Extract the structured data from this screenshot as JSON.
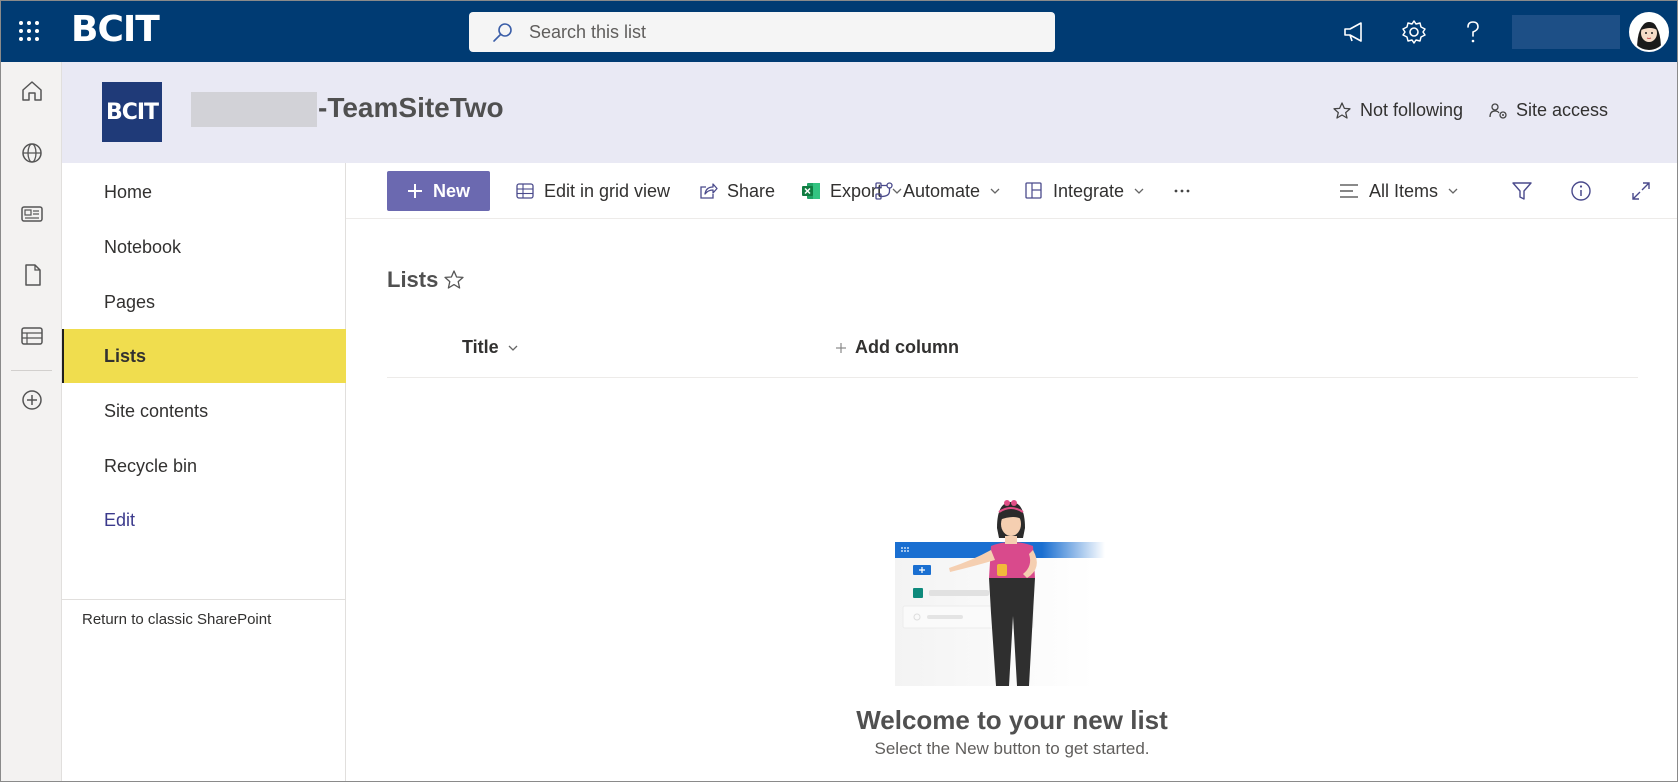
{
  "suite": {
    "brand": "BCIT",
    "search_placeholder": "Search this list"
  },
  "site": {
    "logo_text": "BCIT",
    "title_suffix": "-TeamSiteTwo",
    "follow_label": "Not following",
    "access_label": "Site access"
  },
  "nav": {
    "items": [
      {
        "label": "Home"
      },
      {
        "label": "Notebook"
      },
      {
        "label": "Pages"
      },
      {
        "label": "Lists"
      },
      {
        "label": "Site contents"
      },
      {
        "label": "Recycle bin"
      },
      {
        "label": "Edit"
      }
    ],
    "classic_link": "Return to classic SharePoint"
  },
  "commands": {
    "new": "New",
    "grid": "Edit in grid view",
    "share": "Share",
    "export": "Export",
    "automate": "Automate",
    "integrate": "Integrate",
    "view": "All Items"
  },
  "content": {
    "page_title": "Lists",
    "columns": [
      "Title",
      "Add column"
    ],
    "welcome_title": "Welcome to your new list",
    "welcome_sub": "Select the New button to get started."
  },
  "colors": {
    "suite_bar": "#003b73",
    "site_header": "#e9e9f4",
    "new_button": "#6b69b0",
    "nav_selected": "#f0dd4e"
  }
}
